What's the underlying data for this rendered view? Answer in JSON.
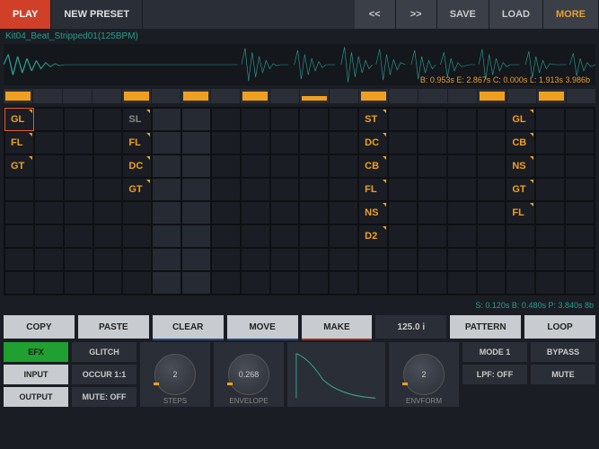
{
  "topbar": {
    "play": "PLAY",
    "preset": "NEW PRESET",
    "prev": "<<",
    "next": ">>",
    "save": "SAVE",
    "load": "LOAD",
    "more": "MORE"
  },
  "filename": "Kit04_Beat_Stripped01(125BPM)",
  "wave_info": "B: 0.953s E: 2.867s C: 0.000s L: 1.913s 3.986b",
  "steps": [
    1,
    0,
    0,
    0,
    1,
    0,
    1,
    0,
    1,
    0,
    0,
    0,
    1,
    0,
    0,
    0,
    1,
    0,
    1,
    0
  ],
  "steps_low": [
    0,
    0,
    0,
    0,
    0,
    0,
    0,
    0,
    0,
    0,
    1,
    0,
    0,
    0,
    0,
    0,
    0,
    0,
    0,
    0
  ],
  "grid": {
    "cols": 20,
    "rows": 8,
    "shaded_cols": [
      5,
      6
    ],
    "selected": {
      "row": 0,
      "col": 0
    },
    "cells": [
      {
        "r": 0,
        "c": 0,
        "t": "GL",
        "cls": "yellow",
        "tick": 1
      },
      {
        "r": 0,
        "c": 4,
        "t": "SL",
        "cls": "grey",
        "tick": 1
      },
      {
        "r": 0,
        "c": 12,
        "t": "ST",
        "cls": "yellow",
        "tick": 1
      },
      {
        "r": 0,
        "c": 17,
        "t": "GL",
        "cls": "yellow",
        "tick": 1
      },
      {
        "r": 1,
        "c": 0,
        "t": "FL",
        "cls": "yellow",
        "tick": 1
      },
      {
        "r": 1,
        "c": 4,
        "t": "FL",
        "cls": "yellow",
        "tick": 1
      },
      {
        "r": 1,
        "c": 12,
        "t": "DC",
        "cls": "yellow",
        "tick": 1
      },
      {
        "r": 1,
        "c": 17,
        "t": "CB",
        "cls": "yellow",
        "tick": 1
      },
      {
        "r": 2,
        "c": 0,
        "t": "GT",
        "cls": "yellow",
        "tick": 1
      },
      {
        "r": 2,
        "c": 4,
        "t": "DC",
        "cls": "yellow",
        "tick": 1
      },
      {
        "r": 2,
        "c": 12,
        "t": "CB",
        "cls": "yellow",
        "tick": 1
      },
      {
        "r": 2,
        "c": 17,
        "t": "NS",
        "cls": "yellow",
        "tick": 1
      },
      {
        "r": 3,
        "c": 4,
        "t": "GT",
        "cls": "yellow",
        "tick": 1
      },
      {
        "r": 3,
        "c": 12,
        "t": "FL",
        "cls": "yellow",
        "tick": 1
      },
      {
        "r": 3,
        "c": 17,
        "t": "GT",
        "cls": "yellow",
        "tick": 1
      },
      {
        "r": 4,
        "c": 12,
        "t": "NS",
        "cls": "yellow",
        "tick": 1
      },
      {
        "r": 4,
        "c": 17,
        "t": "FL",
        "cls": "yellow",
        "tick": 1
      },
      {
        "r": 5,
        "c": 12,
        "t": "D2",
        "cls": "yellow",
        "tick": 1
      }
    ]
  },
  "grid_info": "S: 0.120s B: 0.480s P: 3.840s 8b",
  "actions": {
    "copy": "COPY",
    "paste": "PASTE",
    "clear": "CLEAR",
    "move": "MOVE",
    "make": "MAKE",
    "bpm": "125.0 i",
    "pattern": "PATTERN",
    "loop": "LOOP"
  },
  "bottom": {
    "efx": "EFX",
    "input": "INPUT",
    "output": "OUTPUT",
    "glitch": "GLITCH",
    "occur": "OCCUR 1:1",
    "mute": "MUTE: OFF",
    "steps_val": "2",
    "steps_lbl": "STEPS",
    "env_val": "0.268",
    "env_lbl": "ENVELOPE",
    "envform_val": "2",
    "envform_lbl": "ENVFORM",
    "mode": "MODE 1",
    "lpf": "LPF: OFF",
    "bypass": "BYPASS",
    "mute2": "MUTE"
  }
}
